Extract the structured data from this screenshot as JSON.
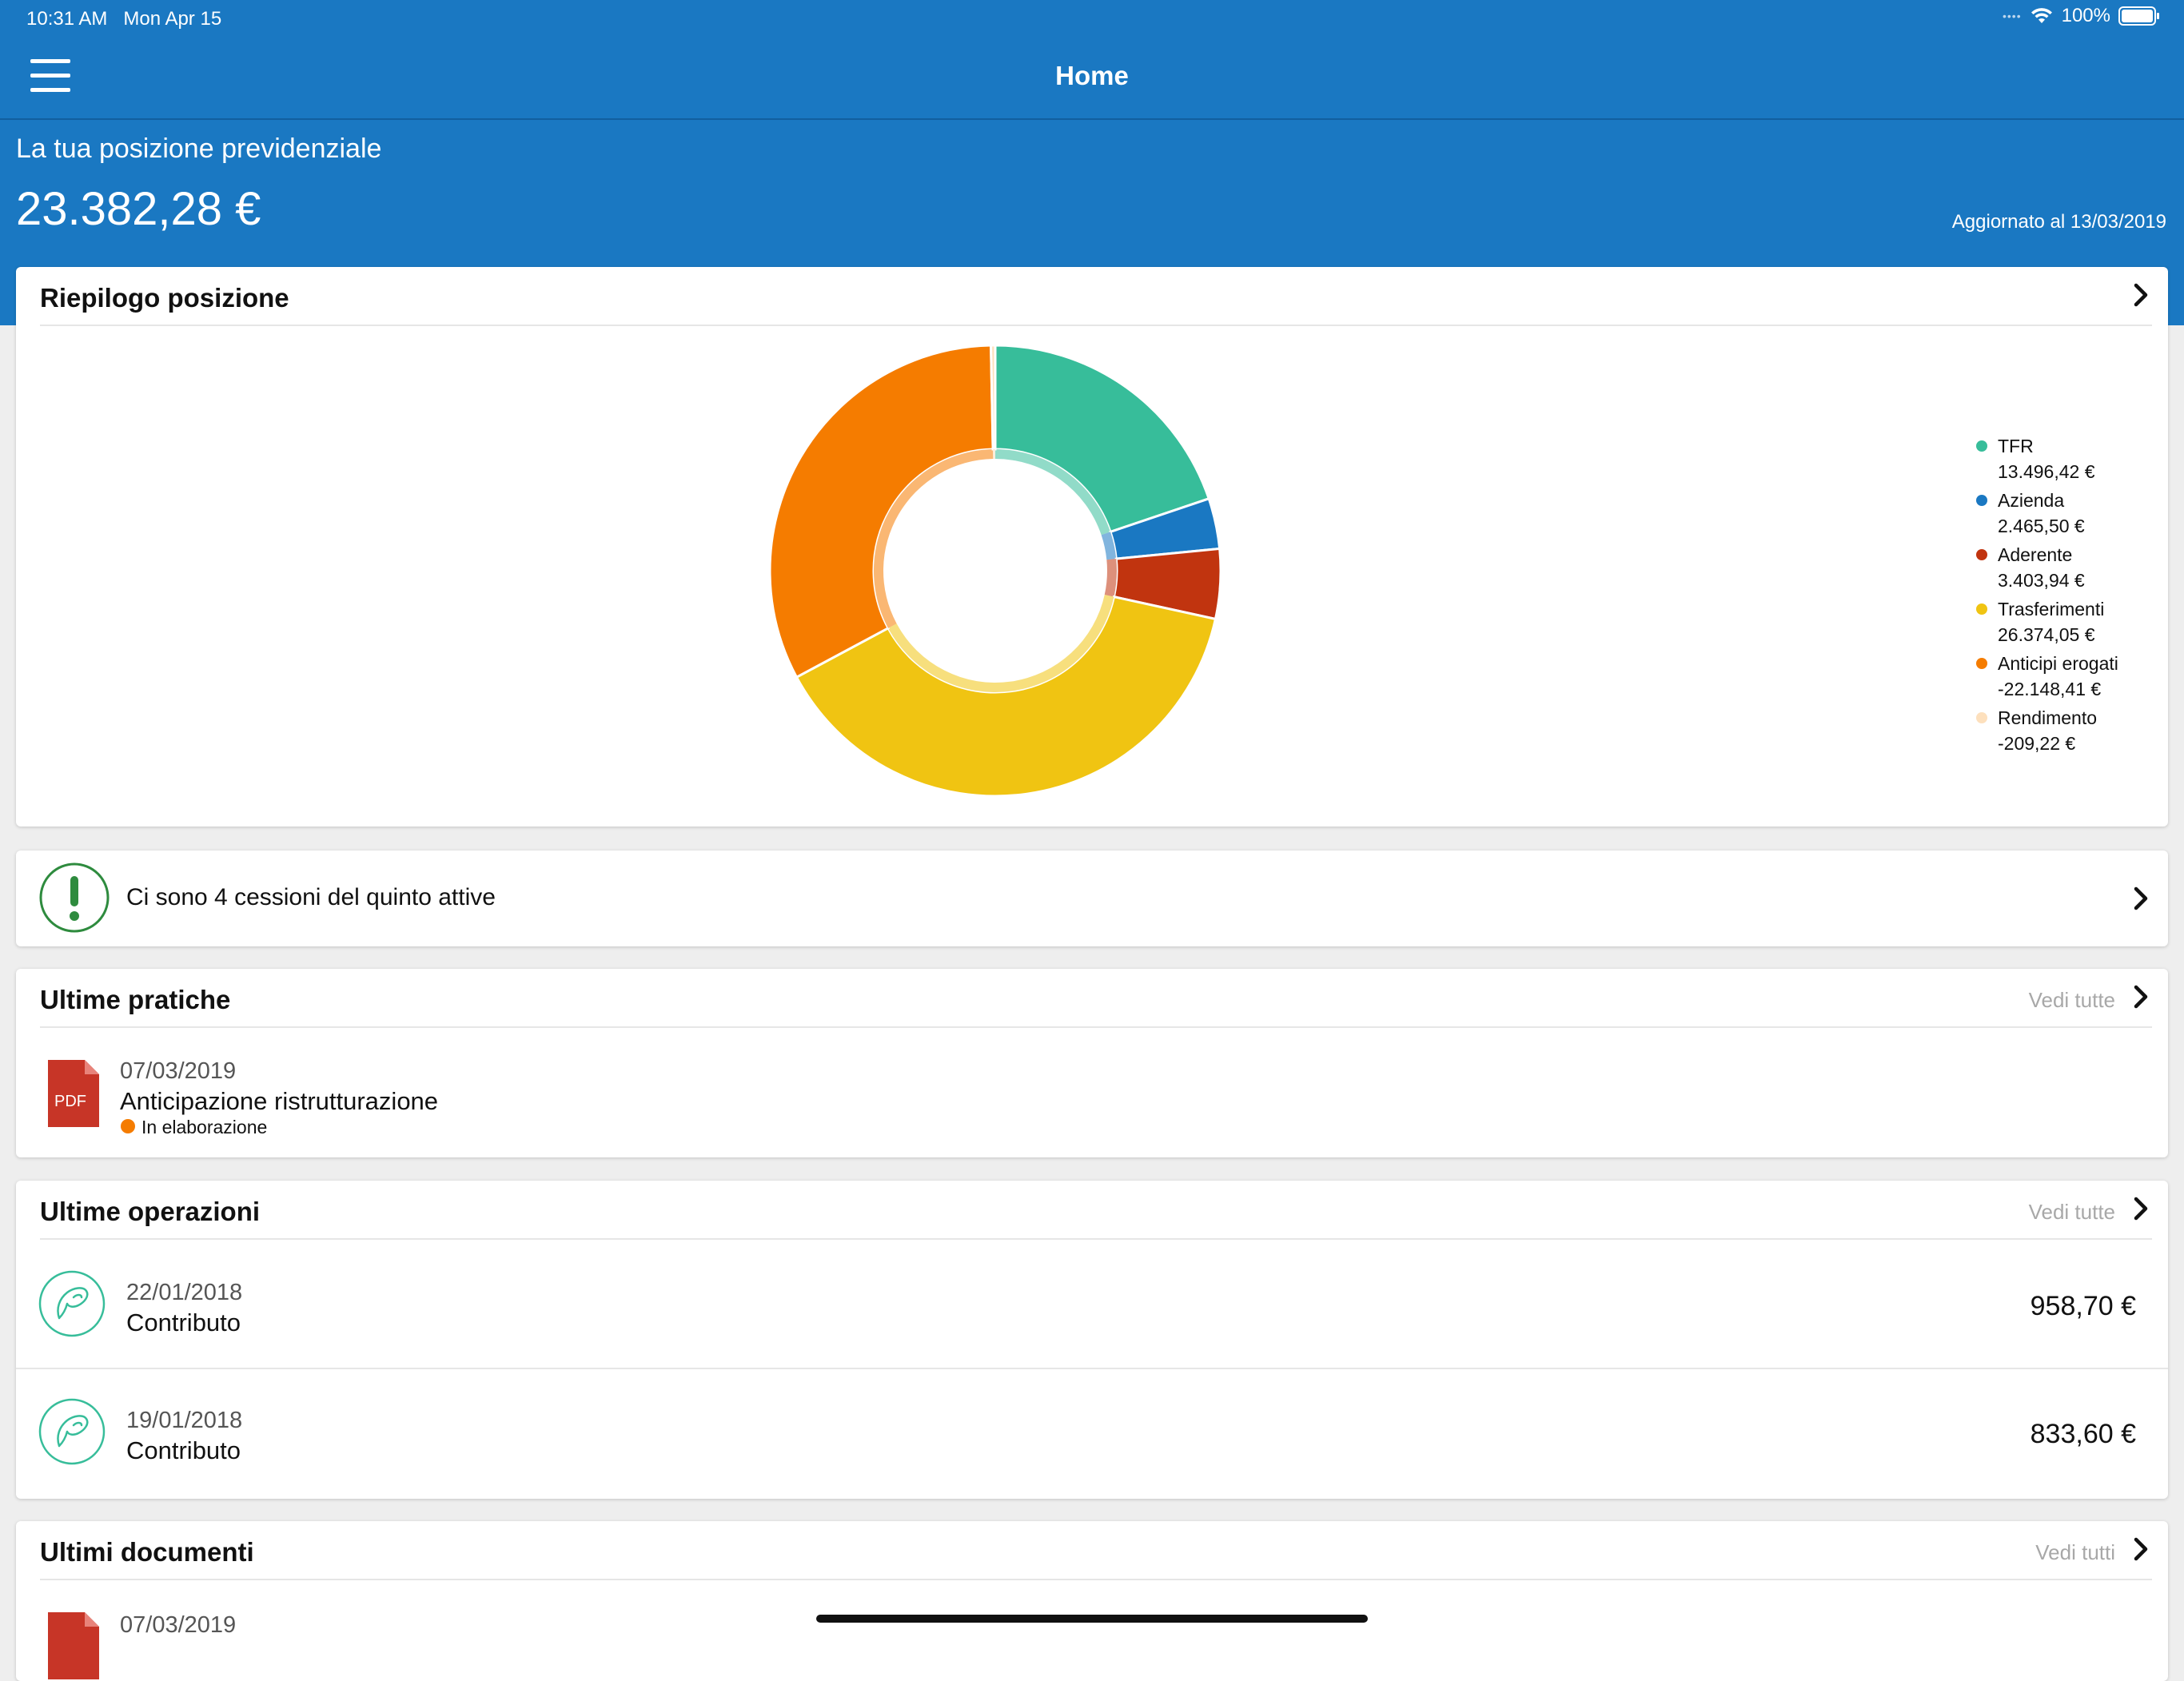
{
  "status_bar": {
    "time": "10:31 AM",
    "date": "Mon Apr 15",
    "battery": "100%"
  },
  "nav": {
    "title": "Home"
  },
  "position": {
    "label": "La tua posizione previdenziale",
    "value": "23.382,28 €",
    "updated": "Aggiornato al 13/03/2019"
  },
  "summary": {
    "title": "Riepilogo posizione"
  },
  "chart_data": {
    "type": "pie",
    "series": [
      {
        "name": "TFR",
        "label": "13.496,42 €",
        "value": 13496.42,
        "color": "#37bd9a"
      },
      {
        "name": "Azienda",
        "label": "2.465,50 €",
        "value": 2465.5,
        "color": "#1a78c2"
      },
      {
        "name": "Aderente",
        "label": "3.403,94 €",
        "value": 3403.94,
        "color": "#c1340f"
      },
      {
        "name": "Trasferimenti",
        "label": "26.374,05 €",
        "value": 26374.05,
        "color": "#f0c412"
      },
      {
        "name": "Anticipi erogati",
        "label": "-22.148,41 €",
        "value": -22148.41,
        "color": "#f57c00"
      },
      {
        "name": "Rendimento",
        "label": "-209,22 €",
        "value": -209.22,
        "color": "#fde0bd"
      }
    ]
  },
  "alert": {
    "text": "Ci sono 4 cessioni del quinto attive"
  },
  "practices": {
    "title": "Ultime pratiche",
    "see_all": "Vedi tutte",
    "items": [
      {
        "date": "07/03/2019",
        "title": "Anticipazione ristrutturazione",
        "status": "In elaborazione",
        "file_type": "PDF",
        "status_color": "#f57c00"
      }
    ]
  },
  "operations": {
    "title": "Ultime operazioni",
    "see_all": "Vedi tutte",
    "items": [
      {
        "date": "22/01/2018",
        "type": "Contributo",
        "amount": "958,70 €"
      },
      {
        "date": "19/01/2018",
        "type": "Contributo",
        "amount": "833,60 €"
      }
    ]
  },
  "documents": {
    "title": "Ultimi documenti",
    "see_all": "Vedi tutti",
    "items": [
      {
        "date": "07/03/2019"
      }
    ]
  }
}
